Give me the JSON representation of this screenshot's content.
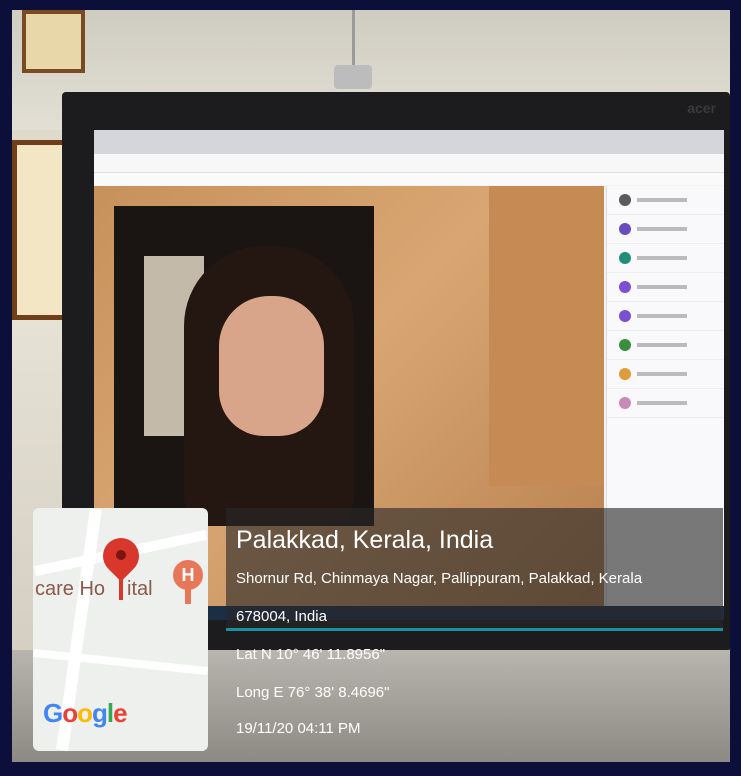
{
  "location": {
    "title": "Palakkad, Kerala, India",
    "address_line1": "Shornur Rd, Chinmaya Nagar, Pallippuram, Palakkad, Kerala",
    "address_line2": "678004, India",
    "latitude": "Lat N 10° 46' 11.8956\"",
    "longitude": "Long E 76° 38' 8.4696\"",
    "datetime": "19/11/20 04:11 PM"
  },
  "map": {
    "label": "care Ho",
    "label2": "ital",
    "hospital_letter": "H",
    "logo": "Google",
    "pin_icon": "map-pin-icon",
    "hospital_icon": "hospital-marker-icon"
  },
  "monitor": {
    "brand": "acer"
  },
  "colors": {
    "frame": "#0c0f3a",
    "pin": "#d9372b",
    "hospital": "#e8775a",
    "info_overlay": "rgba(40,40,40,0.62)",
    "accent_line": "#1a8fa0"
  }
}
